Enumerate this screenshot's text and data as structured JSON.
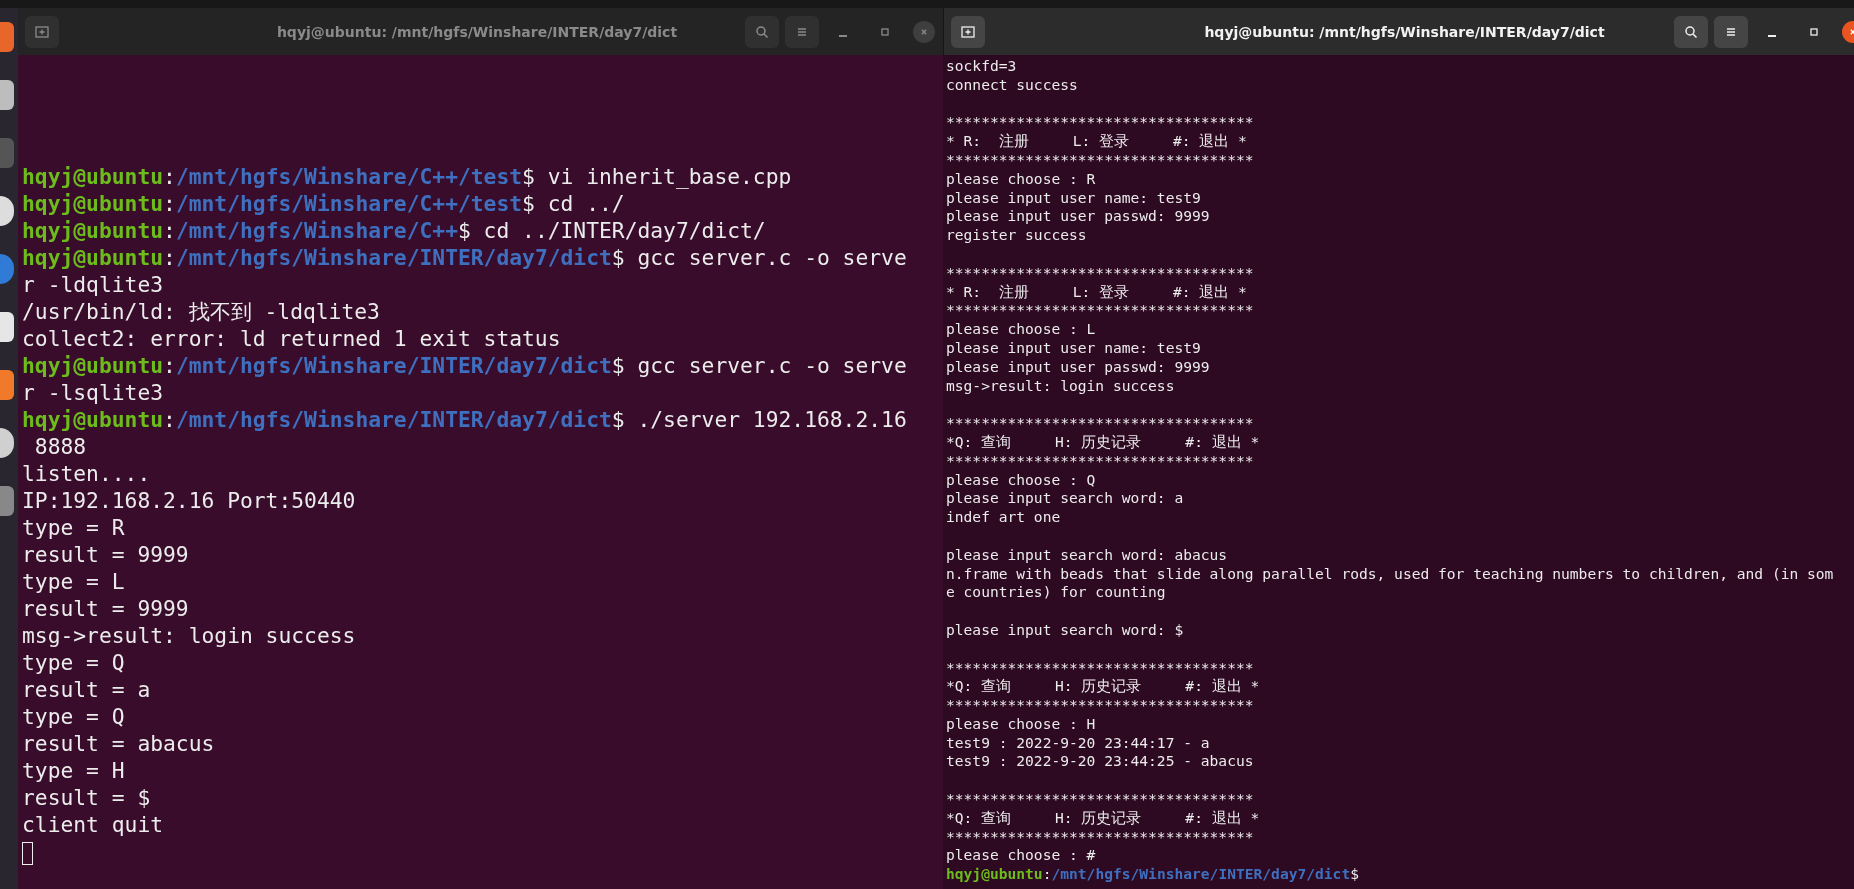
{
  "windows": [
    {
      "title": "hqyj@ubuntu: /mnt/hgfs/Winshare/INTER/day7/dict",
      "focused": false,
      "kind": "large",
      "cursor": true,
      "blocks": [
        [
          {
            "segs": [
              {
                "kind": "user",
                "text": "hqyj@ubuntu"
              },
              {
                "kind": "plain",
                "text": ":"
              },
              {
                "kind": "path",
                "text": "/mnt/hgfs/Winshare/C++/test"
              },
              {
                "kind": "plain",
                "text": "$ vi inherit_base.cpp"
              }
            ]
          },
          {
            "segs": [
              {
                "kind": "user",
                "text": "hqyj@ubuntu"
              },
              {
                "kind": "plain",
                "text": ":"
              },
              {
                "kind": "path",
                "text": "/mnt/hgfs/Winshare/C++/test"
              },
              {
                "kind": "plain",
                "text": "$ cd ../"
              }
            ]
          },
          {
            "segs": [
              {
                "kind": "user",
                "text": "hqyj@ubuntu"
              },
              {
                "kind": "plain",
                "text": ":"
              },
              {
                "kind": "path",
                "text": "/mnt/hgfs/Winshare/C++"
              },
              {
                "kind": "plain",
                "text": "$ cd ../INTER/day7/dict/"
              }
            ]
          },
          {
            "segs": [
              {
                "kind": "user",
                "text": "hqyj@ubuntu"
              },
              {
                "kind": "plain",
                "text": ":"
              },
              {
                "kind": "path",
                "text": "/mnt/hgfs/Winshare/INTER/day7/dict"
              },
              {
                "kind": "plain",
                "text": "$ gcc server.c -o serve"
              }
            ]
          },
          {
            "segs": [
              {
                "kind": "plain",
                "text": "r -ldqlite3"
              }
            ]
          },
          {
            "segs": [
              {
                "kind": "plain",
                "text": "/usr/bin/ld: 找不到 -ldqlite3"
              }
            ]
          },
          {
            "segs": [
              {
                "kind": "plain",
                "text": "collect2: error: ld returned 1 exit status"
              }
            ]
          },
          {
            "segs": [
              {
                "kind": "user",
                "text": "hqyj@ubuntu"
              },
              {
                "kind": "plain",
                "text": ":"
              },
              {
                "kind": "path",
                "text": "/mnt/hgfs/Winshare/INTER/day7/dict"
              },
              {
                "kind": "plain",
                "text": "$ gcc server.c -o serve"
              }
            ]
          },
          {
            "segs": [
              {
                "kind": "plain",
                "text": "r -lsqlite3"
              }
            ]
          },
          {
            "segs": [
              {
                "kind": "user",
                "text": "hqyj@ubuntu"
              },
              {
                "kind": "plain",
                "text": ":"
              },
              {
                "kind": "path",
                "text": "/mnt/hgfs/Winshare/INTER/day7/dict"
              },
              {
                "kind": "plain",
                "text": "$ ./server 192.168.2.16"
              }
            ]
          },
          {
            "segs": [
              {
                "kind": "plain",
                "text": " 8888"
              }
            ]
          },
          {
            "segs": [
              {
                "kind": "plain",
                "text": "listen...."
              }
            ]
          },
          {
            "segs": [
              {
                "kind": "plain",
                "text": "IP:192.168.2.16 Port:50440"
              }
            ]
          },
          {
            "segs": [
              {
                "kind": "plain",
                "text": "type = R"
              }
            ]
          },
          {
            "segs": [
              {
                "kind": "plain",
                "text": "result = 9999"
              }
            ]
          },
          {
            "segs": [
              {
                "kind": "plain",
                "text": "type = L"
              }
            ]
          },
          {
            "segs": [
              {
                "kind": "plain",
                "text": "result = 9999"
              }
            ]
          },
          {
            "segs": [
              {
                "kind": "plain",
                "text": "msg->result: login success"
              }
            ]
          },
          {
            "segs": [
              {
                "kind": "plain",
                "text": "type = Q"
              }
            ]
          },
          {
            "segs": [
              {
                "kind": "plain",
                "text": "result = a"
              }
            ]
          },
          {
            "segs": [
              {
                "kind": "plain",
                "text": "type = Q"
              }
            ]
          },
          {
            "segs": [
              {
                "kind": "plain",
                "text": "result = abacus"
              }
            ]
          },
          {
            "segs": [
              {
                "kind": "plain",
                "text": "type = H"
              }
            ]
          },
          {
            "segs": [
              {
                "kind": "plain",
                "text": "result = $"
              }
            ]
          },
          {
            "segs": [
              {
                "kind": "plain",
                "text": "client quit"
              }
            ]
          }
        ]
      ]
    },
    {
      "title": "hqyj@ubuntu: /mnt/hgfs/Winshare/INTER/day7/dict",
      "focused": true,
      "kind": "small",
      "cursor": false,
      "blocks": [
        [
          {
            "segs": [
              {
                "kind": "plain",
                "text": "sockfd=3"
              }
            ]
          },
          {
            "segs": [
              {
                "kind": "plain",
                "text": "connect success"
              }
            ]
          }
        ],
        [
          {
            "segs": [
              {
                "kind": "plain",
                "text": "***********************************"
              }
            ]
          },
          {
            "segs": [
              {
                "kind": "plain",
                "text": "* R:  注册     L: 登录     #: 退出 *"
              }
            ]
          },
          {
            "segs": [
              {
                "kind": "plain",
                "text": "***********************************"
              }
            ]
          },
          {
            "segs": [
              {
                "kind": "plain",
                "text": "please choose : R"
              }
            ]
          },
          {
            "segs": [
              {
                "kind": "plain",
                "text": "please input user name: test9"
              }
            ]
          },
          {
            "segs": [
              {
                "kind": "plain",
                "text": "please input user passwd: 9999"
              }
            ]
          },
          {
            "segs": [
              {
                "kind": "plain",
                "text": "register success"
              }
            ]
          }
        ],
        [
          {
            "segs": [
              {
                "kind": "plain",
                "text": "***********************************"
              }
            ]
          },
          {
            "segs": [
              {
                "kind": "plain",
                "text": "* R:  注册     L: 登录     #: 退出 *"
              }
            ]
          },
          {
            "segs": [
              {
                "kind": "plain",
                "text": "***********************************"
              }
            ]
          },
          {
            "segs": [
              {
                "kind": "plain",
                "text": "please choose : L"
              }
            ]
          },
          {
            "segs": [
              {
                "kind": "plain",
                "text": "please input user name: test9"
              }
            ]
          },
          {
            "segs": [
              {
                "kind": "plain",
                "text": "please input user passwd: 9999"
              }
            ]
          },
          {
            "segs": [
              {
                "kind": "plain",
                "text": "msg->result: login success"
              }
            ]
          }
        ],
        [
          {
            "segs": [
              {
                "kind": "plain",
                "text": "***********************************"
              }
            ]
          },
          {
            "segs": [
              {
                "kind": "plain",
                "text": "*Q: 查询     H: 历史记录     #: 退出 *"
              }
            ]
          },
          {
            "segs": [
              {
                "kind": "plain",
                "text": "***********************************"
              }
            ]
          },
          {
            "segs": [
              {
                "kind": "plain",
                "text": "please choose : Q"
              }
            ]
          },
          {
            "segs": [
              {
                "kind": "plain",
                "text": "please input search word: a"
              }
            ]
          },
          {
            "segs": [
              {
                "kind": "plain",
                "text": "indef art one"
              }
            ]
          }
        ],
        [
          {
            "segs": [
              {
                "kind": "plain",
                "text": "please input search word: abacus"
              }
            ]
          },
          {
            "segs": [
              {
                "kind": "plain",
                "text": "n.frame with beads that slide along parallel rods, used for teaching numbers to children, and (in som"
              }
            ]
          },
          {
            "segs": [
              {
                "kind": "plain",
                "text": "e countries) for counting"
              }
            ]
          }
        ],
        [
          {
            "segs": [
              {
                "kind": "plain",
                "text": "please input search word: $"
              }
            ]
          }
        ],
        [
          {
            "segs": [
              {
                "kind": "plain",
                "text": "***********************************"
              }
            ]
          },
          {
            "segs": [
              {
                "kind": "plain",
                "text": "*Q: 查询     H: 历史记录     #: 退出 *"
              }
            ]
          },
          {
            "segs": [
              {
                "kind": "plain",
                "text": "***********************************"
              }
            ]
          },
          {
            "segs": [
              {
                "kind": "plain",
                "text": "please choose : H"
              }
            ]
          },
          {
            "segs": [
              {
                "kind": "plain",
                "text": "test9 : 2022-9-20 23:44:17 - a"
              }
            ]
          },
          {
            "segs": [
              {
                "kind": "plain",
                "text": "test9 : 2022-9-20 23:44:25 - abacus"
              }
            ]
          }
        ],
        [
          {
            "segs": [
              {
                "kind": "plain",
                "text": "***********************************"
              }
            ]
          },
          {
            "segs": [
              {
                "kind": "plain",
                "text": "*Q: 查询     H: 历史记录     #: 退出 *"
              }
            ]
          },
          {
            "segs": [
              {
                "kind": "plain",
                "text": "***********************************"
              }
            ]
          },
          {
            "segs": [
              {
                "kind": "plain",
                "text": "please choose : #"
              }
            ]
          },
          {
            "segs": [
              {
                "kind": "user",
                "text": "hqyj@ubuntu"
              },
              {
                "kind": "plain",
                "text": ":"
              },
              {
                "kind": "path",
                "text": "/mnt/hgfs/Winshare/INTER/day7/dict"
              },
              {
                "kind": "plain",
                "text": "$"
              }
            ]
          }
        ]
      ]
    }
  ]
}
